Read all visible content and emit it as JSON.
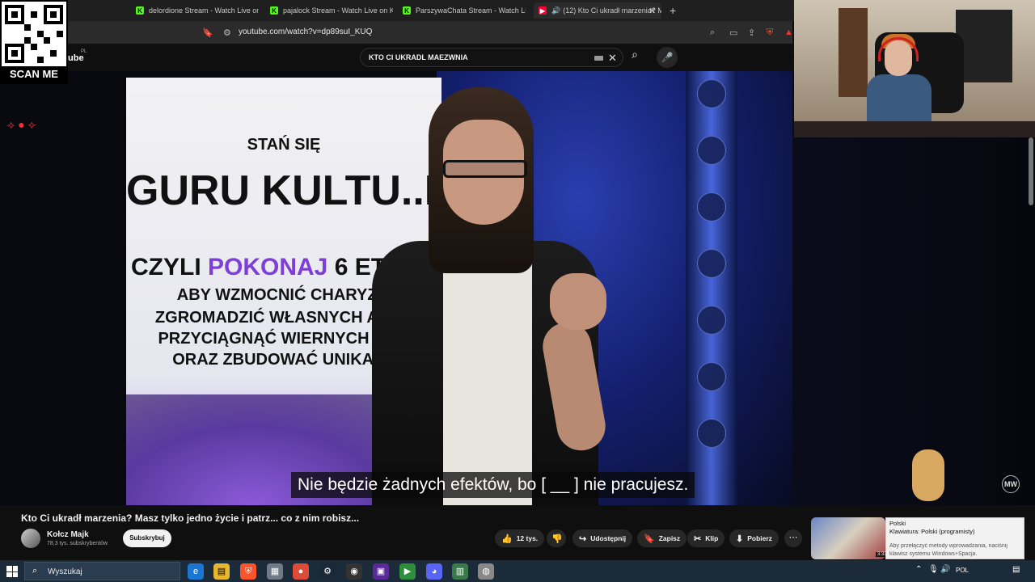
{
  "browser": {
    "tabs": [
      {
        "label": "delordione Stream - Watch Live on K",
        "favicon": "K"
      },
      {
        "label": "pajalock Stream - Watch Live on Kick",
        "favicon": "K"
      },
      {
        "label": "ParszywaChata Stream - Watch Live o",
        "favicon": "K"
      },
      {
        "label": "(12) Kto Ci ukradł marzenia? M",
        "favicon": "▶",
        "active": true
      }
    ],
    "url": "youtube.com/watch?v=dp89suI_KUQ",
    "new_tab_label": "+",
    "close_tab_label": "✕"
  },
  "youtube": {
    "logo_text": "ube",
    "logo_region": "PL",
    "search_query": "KTO CI UKRADL MAEZWNIA"
  },
  "overlay": {
    "qr_label": "SCAN ME",
    "emotes": "⟢ ● ⟣"
  },
  "video": {
    "banner": {
      "line1": "STAŃ SIĘ",
      "line2": "GURU KULTU..RY",
      "line3_a": "CZYLI ",
      "line3_b": "POKONAJ",
      "line3_c": " 6 ETA",
      "line4": "ABY WZMOCNIĆ CHARYZM",
      "line5": "ZGROMADZIĆ WŁASNYCH APOS",
      "line6": "PRZYCIĄGNĄĆ WIERNYCH WYZ",
      "line7": "ORAZ ZBUDOWAĆ UNIKALN"
    },
    "subtitle": "Nie będzie żadnych efektów, bo [ __ ] nie pracujesz.",
    "badge": "MW"
  },
  "meta": {
    "title": "Kto Ci ukradł marzenia? Masz tylko jedno życie i patrz... co z nim robisz...",
    "channel_name": "Kołcz Majk",
    "subscribers": "78,3 tys. subskrybentów",
    "subscribe_label": "Subskrybuj",
    "likes": "12 tys.",
    "share_label": "Udostępnij",
    "save_label": "Zapisz",
    "clip_label": "Klip",
    "download_label": "Pobierz",
    "more_label": "⋯"
  },
  "recommendation": {
    "duration": "3:33"
  },
  "language_popup": {
    "language": "Polski",
    "keyboard": "Klawiatura: Polski (programisty)",
    "hint_1": "Aby przełączyć metody wprowadzania, naciśnij",
    "hint_2": "klawisz systemu Windows+Spacja."
  },
  "taskbar": {
    "search_placeholder": "Wyszukaj",
    "lang_indicator": "POL"
  },
  "colors": {
    "kick_green": "#53fc18",
    "youtube_red": "#ff0033",
    "banner_purple": "#7d3fd6"
  }
}
